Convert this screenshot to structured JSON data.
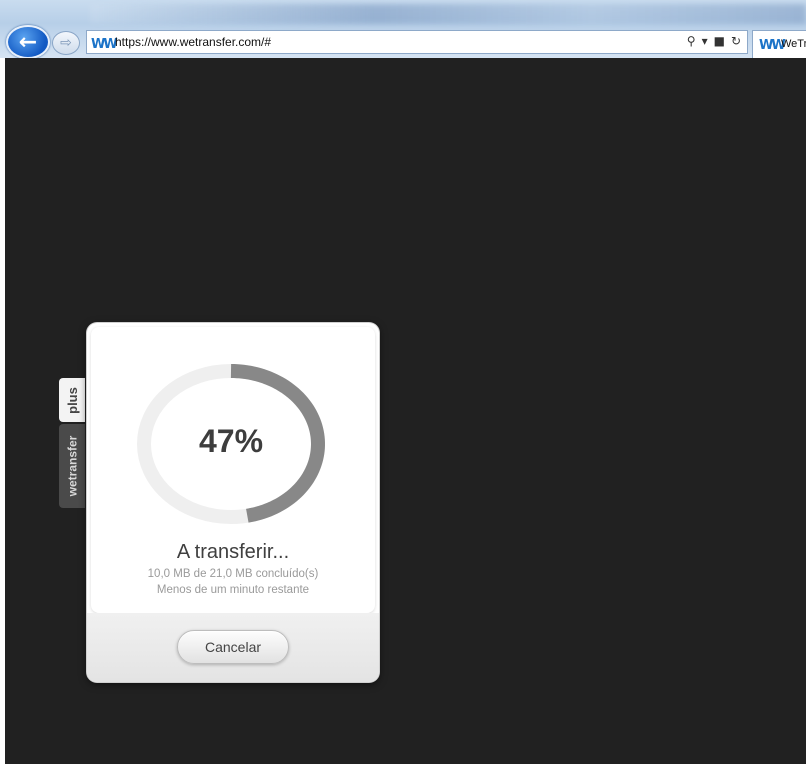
{
  "browser": {
    "url": "https://www.wetransfer.com/#",
    "tab_title": "WeTransfer",
    "colors": {
      "accent": "#1b73c8",
      "back_button": "#1259c3"
    }
  },
  "sidetab": {
    "plus_label": "plus",
    "brand_label": "wetransfer"
  },
  "transfer": {
    "progress": 0.47,
    "percent_label": "47%",
    "title": "A transferir...",
    "detail": "10,0 MB de 21,0 MB concluído(s)",
    "remaining": "Menos de um minuto restante",
    "cancel_label": "Cancelar",
    "colors": {
      "ring_fill": "#888888",
      "ring_track": "#efefef"
    }
  }
}
